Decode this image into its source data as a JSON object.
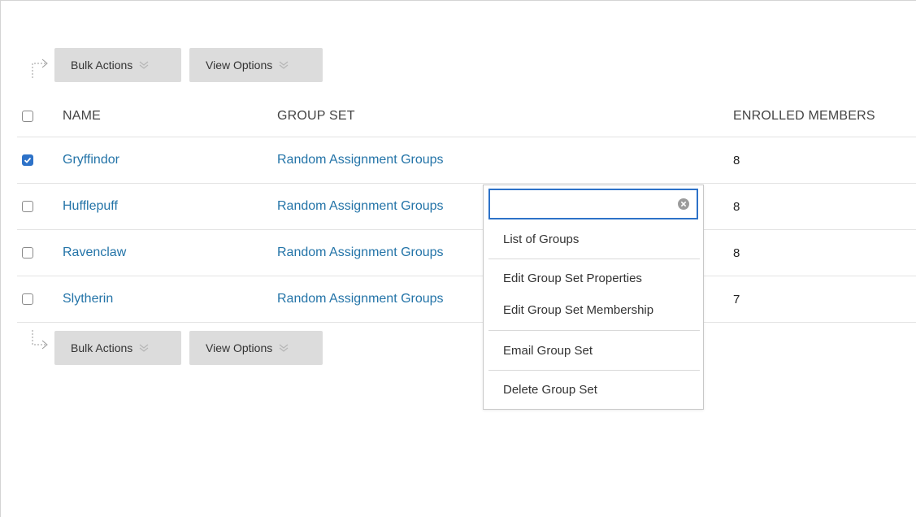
{
  "toolbar_top": {
    "bulk_actions": "Bulk Actions",
    "view_options": "View Options"
  },
  "toolbar_bottom": {
    "bulk_actions": "Bulk Actions",
    "view_options": "View Options"
  },
  "table": {
    "headers": {
      "name": "NAME",
      "group_set": "GROUP SET",
      "enrolled": "ENROLLED MEMBERS"
    },
    "rows": [
      {
        "name": "Gryffindor",
        "group_set": "Random Assignment Groups",
        "enrolled": "8",
        "checked": true
      },
      {
        "name": "Hufflepuff",
        "group_set": "Random Assignment Groups",
        "enrolled": "8",
        "checked": false
      },
      {
        "name": "Ravenclaw",
        "group_set": "Random Assignment Groups",
        "enrolled": "8",
        "checked": false
      },
      {
        "name": "Slytherin",
        "group_set": "Random Assignment Groups",
        "enrolled": "7",
        "checked": false
      }
    ]
  },
  "dropdown": {
    "search_value": "",
    "items": [
      "List of Groups",
      "Edit Group Set Properties",
      "Edit Group Set Membership",
      "Email Group Set",
      "Delete Group Set"
    ]
  },
  "colors": {
    "link": "#2474a8",
    "accent": "#2d72c8",
    "button_bg": "#dcdcdc"
  },
  "icons": {
    "chevron": "double-chevron-down-icon",
    "clear": "clear-circle-x-icon",
    "connector": "bracket-arrow-icon",
    "check": "checkmark-icon"
  }
}
